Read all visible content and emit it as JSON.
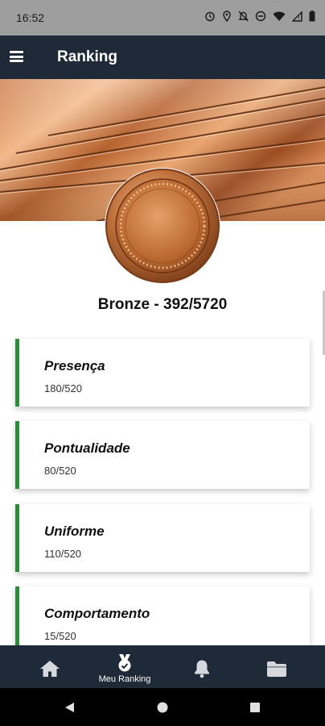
{
  "status_bar": {
    "time": "16:52",
    "icons": [
      "alarm-icon",
      "location-icon",
      "mute-icon",
      "do-not-disturb-icon",
      "wifi-icon",
      "signal-icon",
      "battery-icon"
    ]
  },
  "app_bar": {
    "menu_icon": "hamburger-icon",
    "title": "Ranking"
  },
  "medal": {
    "level": "Bronze",
    "title": "Bronze - 392/5720"
  },
  "categories": [
    {
      "name": "Presença",
      "score": "180/520"
    },
    {
      "name": "Pontualidade",
      "score": "80/520"
    },
    {
      "name": "Uniforme",
      "score": "110/520"
    },
    {
      "name": "Comportamento",
      "score": "15/520"
    }
  ],
  "bottom_nav": {
    "tabs": [
      {
        "icon": "home-icon",
        "label": ""
      },
      {
        "icon": "ranking-medal-icon",
        "label": "Meu Ranking",
        "active": true
      },
      {
        "icon": "bell-icon",
        "label": ""
      },
      {
        "icon": "folder-icon",
        "label": ""
      }
    ]
  },
  "system_nav": [
    "back-icon",
    "home-circle-icon",
    "recents-icon"
  ],
  "colors": {
    "app_bar": "#1e2a38",
    "accent_green": "#1f9430",
    "bronze": "#b86a35"
  }
}
